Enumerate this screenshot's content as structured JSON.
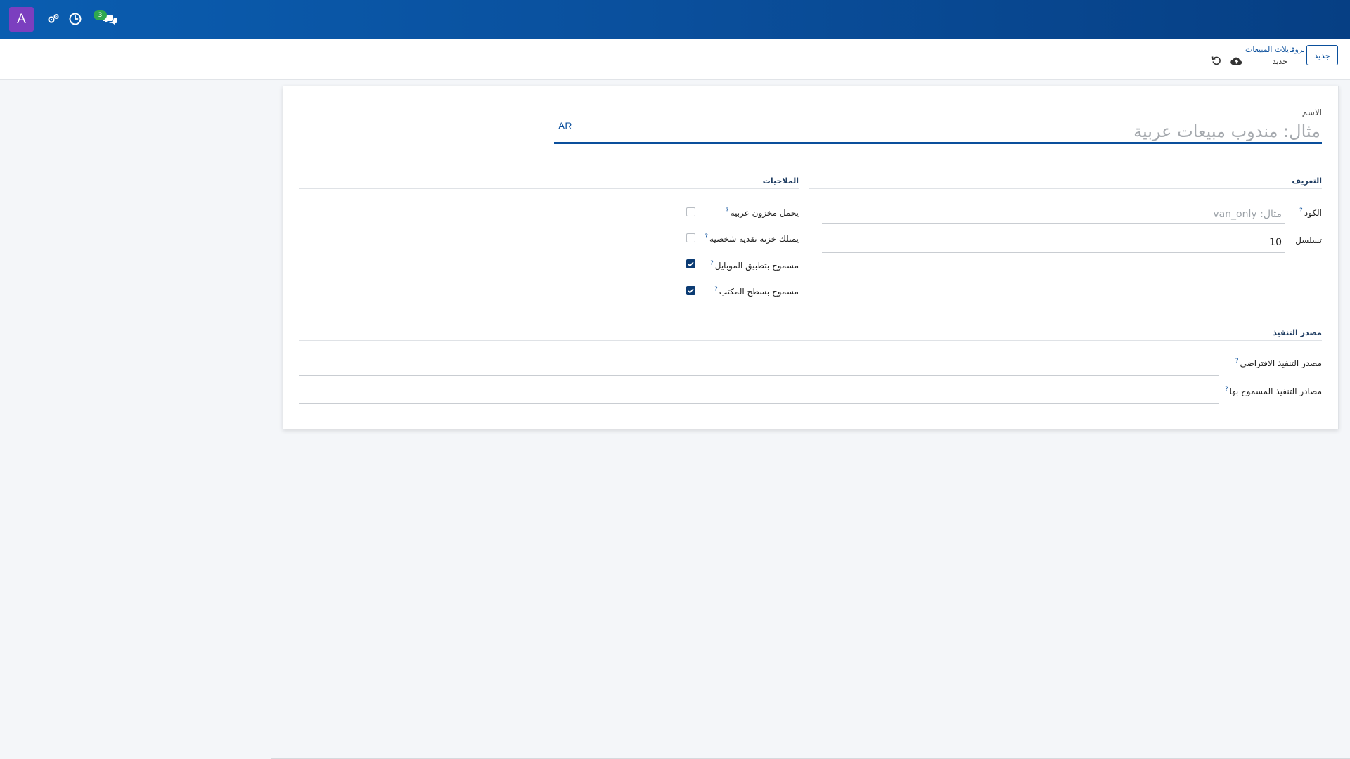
{
  "navbar": {
    "avatar_letter": "A",
    "avatar_color": "#7b3fbf",
    "icons": [
      "settings-cogs-icon",
      "clock-icon",
      "chat-icon"
    ],
    "chat_badge": "3"
  },
  "control_panel": {
    "new_button": "جديد",
    "breadcrumb_parent": "بروفايلات المبيعات",
    "breadcrumb_current": "جديد",
    "icons": [
      "cloud-save-icon",
      "discard-undo-icon"
    ]
  },
  "form": {
    "name_label": "الاسم",
    "name_placeholder": "مثال: مندوب مبيعات عربية",
    "name_value": "",
    "lang_button": "AR",
    "identification": {
      "title": "التعريف",
      "code_label": "الكود",
      "code_help": "?",
      "code_placeholder": "مثال: van_only",
      "code_value": "",
      "sequence_label": "تسلسل",
      "sequence_value": "10"
    },
    "permissions": {
      "title": "الملاحيات",
      "items": [
        {
          "label": "يحمل مخزون عربية",
          "help": "?",
          "checked": false
        },
        {
          "label": "يمتلك خزنة نقدية شخصية",
          "help": "?",
          "checked": false
        },
        {
          "label": "مسموح بتطبيق الموبايل",
          "help": "?",
          "checked": true
        },
        {
          "label": "مسموح بسطح المكتب",
          "help": "?",
          "checked": true
        }
      ]
    },
    "execution_source": {
      "title": "مصدر التنفيذ",
      "default_label": "مصدر التنفيذ الافتراضي",
      "default_help": "?",
      "default_value": "",
      "allowed_label": "مصادر التنفيذ المسموح بها",
      "allowed_help": "?",
      "allowed_value": ""
    }
  },
  "colors": {
    "primary": "#0a4f9c",
    "checkbox_checked": "#0b3b73",
    "badge": "#2fa84f"
  }
}
